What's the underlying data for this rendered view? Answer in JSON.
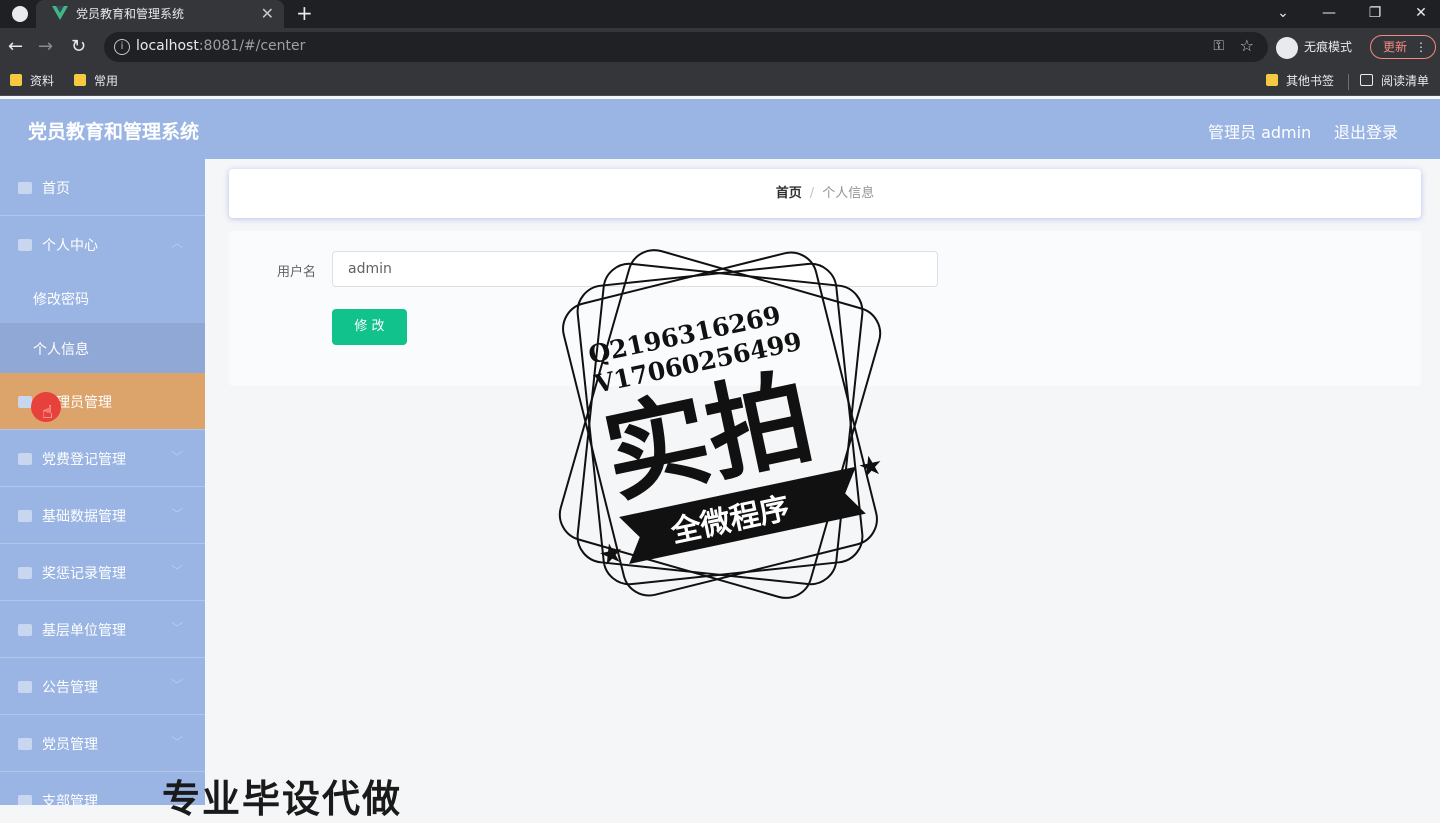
{
  "browser": {
    "tab_title": "党员教育和管理系统",
    "tab_close": "✕",
    "new_tab": "+",
    "url_host": "localhost",
    "url_rest": ":8081/#/center",
    "incognito_label": "无痕模式",
    "update_label": "更新",
    "bookmarks": [
      "资料",
      "常用"
    ],
    "bookmarks_right": [
      "其他书签",
      "阅读清单"
    ]
  },
  "app": {
    "title": "党员教育和管理系统",
    "admin_label": "管理员 admin",
    "logout_label": "退出登录"
  },
  "sidebar": {
    "items": [
      {
        "label": "首页",
        "icon": "home-icon"
      },
      {
        "label": "个人中心",
        "icon": "user-icon"
      },
      {
        "label": "管理员管理",
        "icon": "monitor-icon"
      },
      {
        "label": "党费登记管理",
        "icon": "user-icon"
      },
      {
        "label": "基础数据管理",
        "icon": "chart-icon"
      },
      {
        "label": "奖惩记录管理",
        "icon": "monitor-icon"
      },
      {
        "label": "基层单位管理",
        "icon": "building-icon"
      },
      {
        "label": "公告管理",
        "icon": "list-icon"
      },
      {
        "label": "党员管理",
        "icon": "book-icon"
      },
      {
        "label": "支部管理",
        "icon": "book-icon"
      }
    ],
    "submenu": [
      "修改密码",
      "个人信息"
    ]
  },
  "breadcrumb": {
    "home": "首页",
    "separator": "/",
    "current": "个人信息"
  },
  "form": {
    "username_label": "用户名",
    "username_value": "admin",
    "submit_label": "修 改"
  },
  "watermark": {
    "line1": "Q2196316269",
    "line2": "V17060256499",
    "big_text": "实拍",
    "banner_text": "全微程序",
    "bottom_text": "专业毕设代做"
  }
}
